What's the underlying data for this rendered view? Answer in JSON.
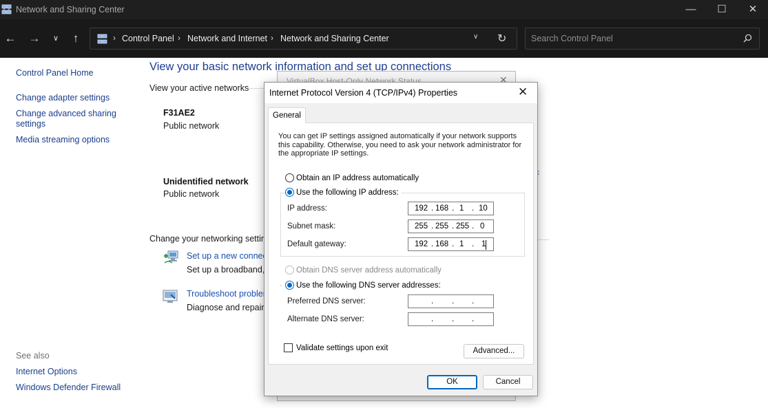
{
  "window": {
    "title": "Network and Sharing Center",
    "minimize": "—",
    "maximize": "☐",
    "close": "✕"
  },
  "addressbar": {
    "back": "←",
    "forward": "→",
    "recent": "∨",
    "up": "↑",
    "breadcrumbs": [
      "Control Panel",
      "Network and Internet",
      "Network and Sharing Center"
    ],
    "separator": "›",
    "dropdown": "∨",
    "refresh": "↻",
    "search_placeholder": "Search Control Panel"
  },
  "leftnav": {
    "items": [
      "Control Panel Home",
      "Change adapter settings",
      "Change advanced sharing",
      "settings",
      "Media streaming options"
    ]
  },
  "seealso": {
    "heading": "See also",
    "items": [
      "Internet Options",
      "Windows Defender Firewall"
    ]
  },
  "main": {
    "heading": "View your basic network information and set up connections",
    "active_networks_label": "View your active networks",
    "networks": [
      {
        "name": "F31AE2",
        "category": "Public network"
      },
      {
        "name": "Unidentified network",
        "category": "Public network"
      }
    ],
    "change_settings_label": "Change your networking setting",
    "tasks": [
      {
        "link": "Set up a new connect",
        "desc": "Set up a broadband, c"
      },
      {
        "link": "Troubleshoot problen",
        "desc": "Diagnose and repair n"
      }
    ],
    "edge_mark": "ɛ"
  },
  "bg_dialog": {
    "title": "VirtualBox Host-Only Network Status",
    "close": "✕"
  },
  "dialog": {
    "title": "Internet Protocol Version 4 (TCP/IPv4) Properties",
    "close": "✕",
    "tab": "General",
    "intro": "You can get IP settings assigned automatically if your network supports this capability. Otherwise, you need to ask your network administrator for the appropriate IP settings.",
    "ip_auto_label": "Obtain an IP address automatically",
    "ip_manual_label": "Use the following IP address:",
    "ip_mode": "manual",
    "fields": {
      "ip_label": "IP address:",
      "ip_value": [
        "192",
        "168",
        "1",
        "10"
      ],
      "subnet_label": "Subnet mask:",
      "subnet_value": [
        "255",
        "255",
        "255",
        "0"
      ],
      "gateway_label": "Default gateway:",
      "gateway_value": [
        "192",
        "168",
        "1",
        "1"
      ]
    },
    "dns_auto_label": "Obtain DNS server address automatically",
    "dns_manual_label": "Use the following DNS server addresses:",
    "dns_mode": "manual",
    "dns": {
      "preferred_label": "Preferred DNS server:",
      "alternate_label": "Alternate DNS server:",
      "dot": "."
    },
    "validate_label": "Validate settings upon exit",
    "validate_checked": false,
    "advanced_label": "Advanced...",
    "ok_label": "OK",
    "cancel_label": "Cancel"
  }
}
